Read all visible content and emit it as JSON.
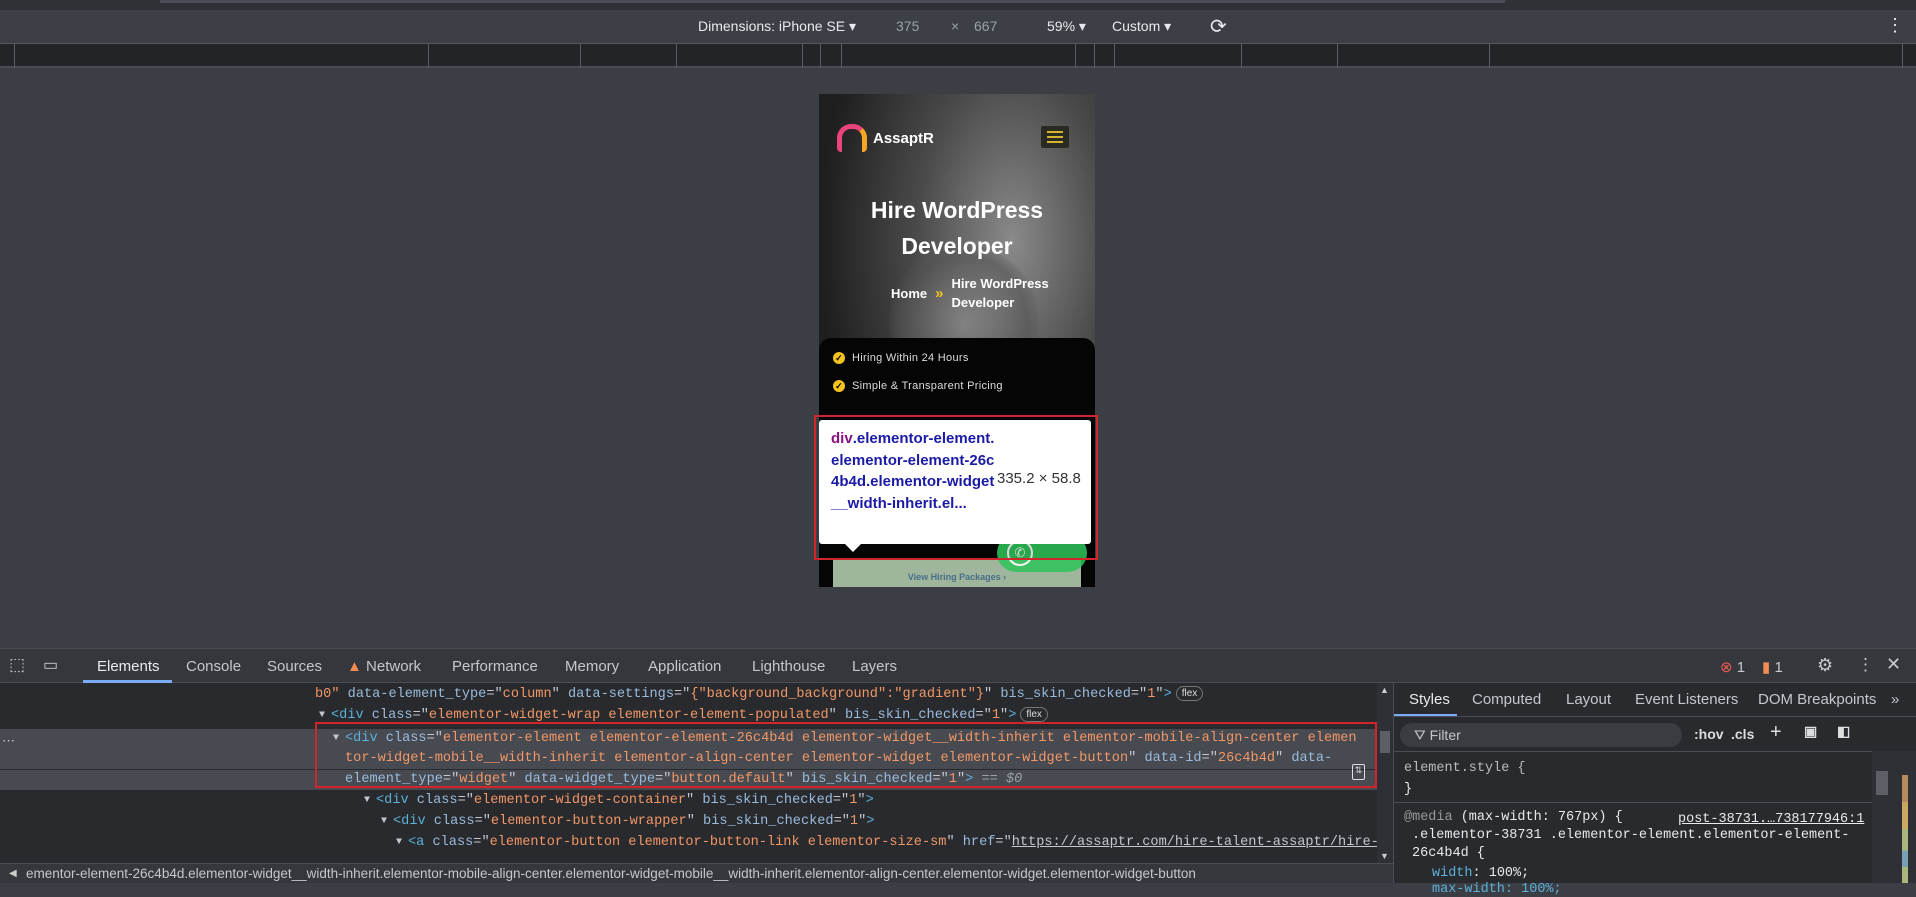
{
  "toolbar": {
    "dimensions_label": "Dimensions: iPhone SE",
    "width": "375",
    "times": "×",
    "height": "667",
    "zoom": "59%",
    "throttle": "Custom"
  },
  "page": {
    "logo_text": "AssaptR",
    "title_line1": "Hire WordPress",
    "title_line2": "Developer",
    "breadcrumb": {
      "home": "Home",
      "separator": "»",
      "current": "Hire WordPress Developer"
    },
    "features": [
      "Hiring Within 24 Hours",
      "Simple & Transparent Pricing"
    ],
    "package_button": "View Hiring Packages ›"
  },
  "tooltip": {
    "tag": "div",
    "selector": ".elementor-element.elementor-element-26c4b4d.elementor-widget__width-inherit.el...",
    "size": "335.2 × 58.8"
  },
  "devtools": {
    "tabs": [
      "Elements",
      "Console",
      "Sources",
      "Network",
      "Performance",
      "Memory",
      "Application",
      "Lighthouse",
      "Layers"
    ],
    "active_tab": "Elements",
    "errors": "1",
    "warnings": "1",
    "code_lines": [
      {
        "indent": 315,
        "tri": false,
        "badge": "flex",
        "seg": [
          [
            "av",
            "b0\""
          ],
          [
            "p",
            " "
          ],
          [
            "an",
            "data-element_type"
          ],
          [
            "p",
            "=\""
          ],
          [
            "av",
            "column"
          ],
          [
            "p",
            "\" "
          ],
          [
            "an",
            "data-settings"
          ],
          [
            "p",
            "=\""
          ],
          [
            "av",
            "{\"background_background\":\"gradient\"}"
          ],
          [
            "p",
            "\" "
          ],
          [
            "an",
            "bis_skin_checked"
          ],
          [
            "p",
            "=\""
          ],
          [
            "av",
            "1"
          ],
          [
            "p",
            "\""
          ],
          [
            "t",
            ">"
          ]
        ]
      },
      {
        "indent": 331,
        "tri": true,
        "badge": "flex",
        "seg": [
          [
            "t",
            "<div "
          ],
          [
            "an",
            "class"
          ],
          [
            "p",
            "=\""
          ],
          [
            "av",
            "elementor-widget-wrap elementor-element-populated"
          ],
          [
            "p",
            "\" "
          ],
          [
            "an",
            "bis_skin_checked"
          ],
          [
            "p",
            "=\""
          ],
          [
            "av",
            "1"
          ],
          [
            "p",
            "\""
          ],
          [
            "t",
            ">"
          ]
        ]
      },
      {
        "indent": 345,
        "tri": true,
        "sel": true,
        "seg": [
          [
            "t",
            "<div "
          ],
          [
            "an",
            "class"
          ],
          [
            "p",
            "=\""
          ],
          [
            "av",
            "elementor-element elementor-element-26c4b4d elementor-widget__width-inherit elementor-mobile-align-center elemen"
          ]
        ]
      },
      {
        "indent": 345,
        "tri": false,
        "sel": true,
        "seg": [
          [
            "av",
            "tor-widget-mobile__width-inherit elementor-align-center elementor-widget elementor-widget-button"
          ],
          [
            "p",
            "\" "
          ],
          [
            "an",
            "data-id"
          ],
          [
            "p",
            "=\""
          ],
          [
            "av",
            "26c4b4d"
          ],
          [
            "p",
            "\" "
          ],
          [
            "an",
            "data-"
          ]
        ]
      },
      {
        "indent": 345,
        "tri": false,
        "sel": true,
        "seg": [
          [
            "an",
            "element_type"
          ],
          [
            "p",
            "=\""
          ],
          [
            "av",
            "widget"
          ],
          [
            "p",
            "\" "
          ],
          [
            "an",
            "data-widget_type"
          ],
          [
            "p",
            "=\""
          ],
          [
            "av",
            "button.default"
          ],
          [
            "p",
            "\" "
          ],
          [
            "an",
            "bis_skin_checked"
          ],
          [
            "p",
            "=\""
          ],
          [
            "av",
            "1"
          ],
          [
            "p",
            "\""
          ],
          [
            "t",
            ">"
          ],
          [
            "dl",
            " == $0"
          ]
        ]
      },
      {
        "indent": 376,
        "tri": true,
        "seg": [
          [
            "t",
            "<div "
          ],
          [
            "an",
            "class"
          ],
          [
            "p",
            "=\""
          ],
          [
            "av",
            "elementor-widget-container"
          ],
          [
            "p",
            "\" "
          ],
          [
            "an",
            "bis_skin_checked"
          ],
          [
            "p",
            "=\""
          ],
          [
            "av",
            "1"
          ],
          [
            "p",
            "\""
          ],
          [
            "t",
            ">"
          ]
        ]
      },
      {
        "indent": 393,
        "tri": true,
        "seg": [
          [
            "t",
            "<div "
          ],
          [
            "an",
            "class"
          ],
          [
            "p",
            "=\""
          ],
          [
            "av",
            "elementor-button-wrapper"
          ],
          [
            "p",
            "\" "
          ],
          [
            "an",
            "bis_skin_checked"
          ],
          [
            "p",
            "=\""
          ],
          [
            "av",
            "1"
          ],
          [
            "p",
            "\""
          ],
          [
            "t",
            ">"
          ]
        ]
      },
      {
        "indent": 408,
        "tri": true,
        "seg": [
          [
            "t",
            "<a "
          ],
          [
            "an",
            "class"
          ],
          [
            "p",
            "=\""
          ],
          [
            "av",
            "elementor-button elementor-button-link elementor-size-sm"
          ],
          [
            "p",
            "\" "
          ],
          [
            "an",
            "href"
          ],
          [
            "p",
            "=\""
          ],
          [
            "u",
            "https://assaptr.com/hire-talent-assaptr/hire-"
          ]
        ]
      }
    ],
    "breadcrumb_bar": "ementor-element-26c4b4d.elementor-widget__width-inherit.elementor-mobile-align-center.elementor-widget-mobile__width-inherit.elementor-align-center.elementor-widget.elementor-widget-button",
    "styles": {
      "tabs": [
        "Styles",
        "Computed",
        "Layout",
        "Event Listeners",
        "DOM Breakpoints"
      ],
      "filter_placeholder": "Filter",
      "hov": ":hov",
      "cls": ".cls",
      "element_style": "element.style {",
      "close_brace": "}",
      "media_kw": "@media",
      "media_query": " (max-width: 767px) {",
      "source_link": "post-38731.…738177946:1",
      "selector_line1": ".elementor-38731 .elementor-element.elementor-element-",
      "selector_line2": "26c4b4d {",
      "prop1_name": "width",
      "prop1_value": ": 100%;",
      "prop2_partial": "max-width: 100%;"
    }
  },
  "colors": {
    "highlight": "#d0262b",
    "accent": "#f4c320",
    "tab_underline": "#7cacf8"
  }
}
